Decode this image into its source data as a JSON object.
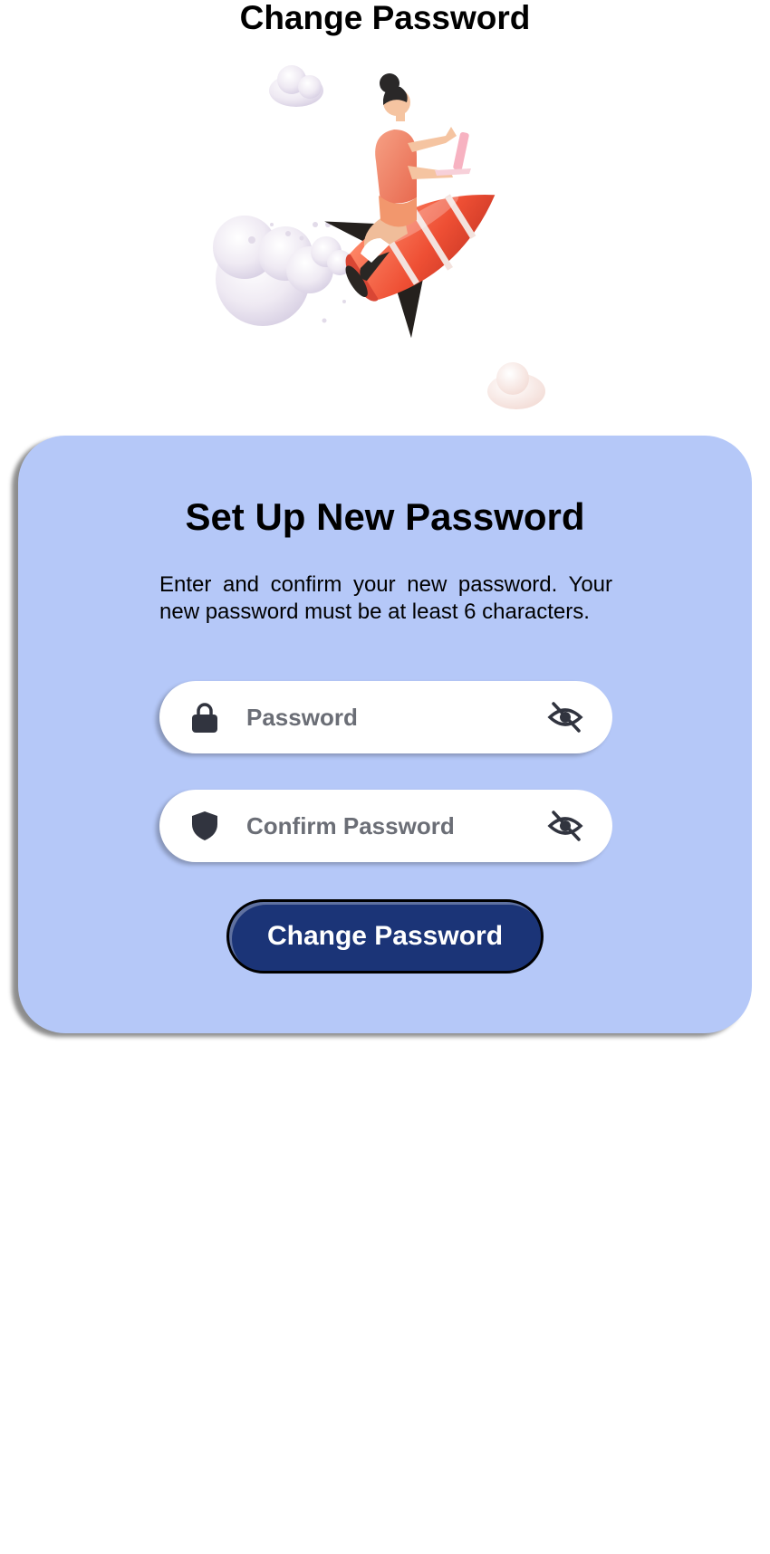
{
  "page": {
    "title": "Change Password"
  },
  "hero": {
    "illustration": "woman-riding-rocket-with-clouds"
  },
  "card": {
    "title": "Set Up New Password",
    "description": "Enter and confirm your new password. Your new password must be at least 6 characters.",
    "password_field": {
      "placeholder": "Password",
      "value": "",
      "icon": "lock-icon",
      "toggle_icon": "eye-slash-icon"
    },
    "confirm_field": {
      "placeholder": "Confirm Password",
      "value": "",
      "icon": "shield-icon",
      "toggle_icon": "eye-slash-icon"
    },
    "submit_label": "Change Password"
  },
  "colors": {
    "card_background": "#b5c8f8",
    "button_background": "#1b3477",
    "icon_color": "#31343f",
    "placeholder_color": "#6b6e76"
  }
}
